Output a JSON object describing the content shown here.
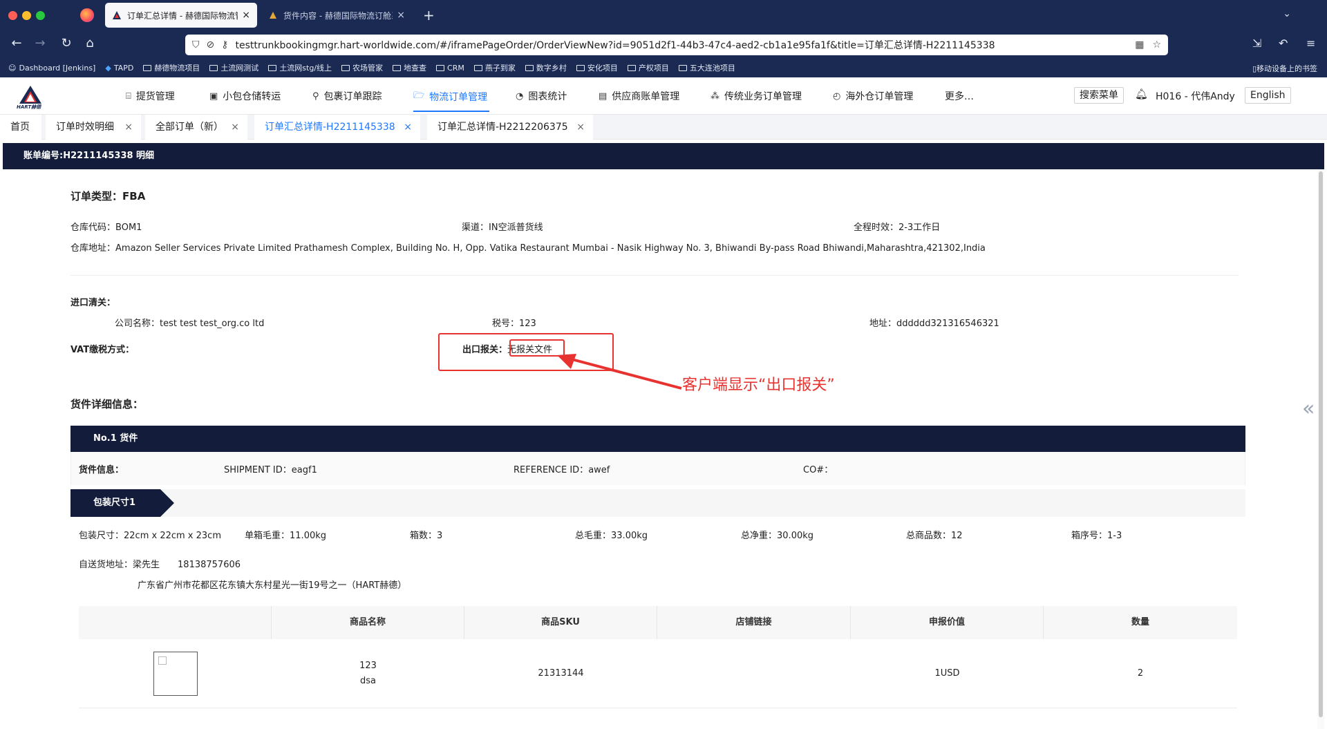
{
  "browser": {
    "tabs": [
      {
        "label": "订单汇总详情 - 赫德国际物流管理",
        "active": true
      },
      {
        "label": "货件内容 - 赫德国际物流订舱系统",
        "active": false
      }
    ],
    "url": "testtrunkbookingmgr.hart-worldwide.com/#/iframePageOrder/OrderViewNew?id=9051d2f1-44b3-47c4-aed2-cb1a1e95fa1f&title=订单汇总详情-H2211145338",
    "bookmarks": [
      "Dashboard [Jenkins]",
      "TAPD",
      "赫德物流项目",
      "土流网测试",
      "土流网stg/线上",
      "农场管家",
      "地查查",
      "CRM",
      "燕子到家",
      "数字乡村",
      "安化项目",
      "产权项目",
      "五大连池项目"
    ],
    "bookmarks_right": "移动设备上的书签"
  },
  "app": {
    "logo_text": "HART赫德",
    "menu": [
      {
        "label": "提货管理",
        "icon": "truck-icon"
      },
      {
        "label": "小包仓储转运",
        "icon": "box-icon"
      },
      {
        "label": "包裹订单跟踪",
        "icon": "search-icon"
      },
      {
        "label": "物流订单管理",
        "icon": "folder-icon",
        "active": true
      },
      {
        "label": "图表统计",
        "icon": "pie-icon"
      },
      {
        "label": "供应商账单管理",
        "icon": "bill-icon"
      },
      {
        "label": "传统业务订单管理",
        "icon": "tree-icon"
      },
      {
        "label": "海外仓订单管理",
        "icon": "gauge-icon"
      },
      {
        "label": "更多…",
        "icon": ""
      }
    ],
    "search_menu": "搜索菜单",
    "user": "H016 - 代伟Andy",
    "language": "English",
    "accent": "#1e78ff"
  },
  "page_tabs": [
    {
      "label": "首页",
      "closable": false
    },
    {
      "label": "订单时效明细",
      "closable": true
    },
    {
      "label": "全部订单（新）",
      "closable": true
    },
    {
      "label": "订单汇总详情-H2211145338",
      "closable": true,
      "active": true
    },
    {
      "label": "订单汇总详情-H2212206375",
      "closable": true
    }
  ],
  "close_glyph": "×",
  "detail": {
    "title": "账单编号:H2211145338 明细",
    "order_type_label": "订单类型：",
    "order_type": "FBA",
    "warehouse_code_label": "仓库代码：",
    "warehouse_code": "BOM1",
    "channel_label": "渠道：",
    "channel": "IN空派普货线",
    "timeliness_label": "全程时效：",
    "timeliness": "2-3工作日",
    "warehouse_addr_label": "仓库地址：",
    "warehouse_addr": "Amazon Seller Services Private Limited Prathamesh Complex, Building No. H, Opp. Vatika Restaurant Mumbai - Nasik Highway No. 3, Bhiwandi By-pass Road Bhiwandi,Maharashtra,421302,India",
    "import_label": "进口清关：",
    "company_label": "公司名称：",
    "company": "test test test_org.co ltd",
    "tax_label": "税号：",
    "tax": "123",
    "addr_label": "地址：",
    "addr": "dddddd321316546321",
    "vat_label": "VAT缴税方式：",
    "export_label": "出口报关：",
    "export_value": "无报关文件",
    "annotation": "客户端显示“出口报关”",
    "annotation_color": "#e8322f",
    "cargo_section": "货件详细信息："
  },
  "cargo": {
    "header": "No.1 货件",
    "info_label": "货件信息：",
    "shipment_id_label": "SHIPMENT ID：",
    "shipment_id": "eagf1",
    "reference_id_label": "REFERENCE ID：",
    "reference_id": "awef",
    "co_label": "CO#：",
    "package_tag": "包装尺寸1",
    "metrics": [
      {
        "label": "包装尺寸：",
        "value": "22cm x 22cm x 23cm"
      },
      {
        "label": "单箱毛重：",
        "value": "11.00kg"
      },
      {
        "label": "箱数：",
        "value": "3"
      },
      {
        "label": "总毛重：",
        "value": "33.00kg"
      },
      {
        "label": "总净重：",
        "value": "30.00kg"
      },
      {
        "label": "总商品数：",
        "value": "12"
      },
      {
        "label": "箱序号：",
        "value": "1-3"
      }
    ],
    "self_delivery_label": "自送货地址：",
    "contact_name": "梁先生",
    "contact_phone": "18138757606",
    "delivery_address": "广东省广州市花都区花东镇大东村星光一街19号之一（HART赫德）",
    "table": {
      "headers": [
        "",
        "商品名称",
        "商品SKU",
        "店铺链接",
        "申报价值",
        "数量"
      ],
      "rows": [
        {
          "name_line1": "123",
          "name_line2": "dsa",
          "sku": "21313144",
          "link": "",
          "value": "1USD",
          "qty": "2"
        }
      ]
    }
  }
}
